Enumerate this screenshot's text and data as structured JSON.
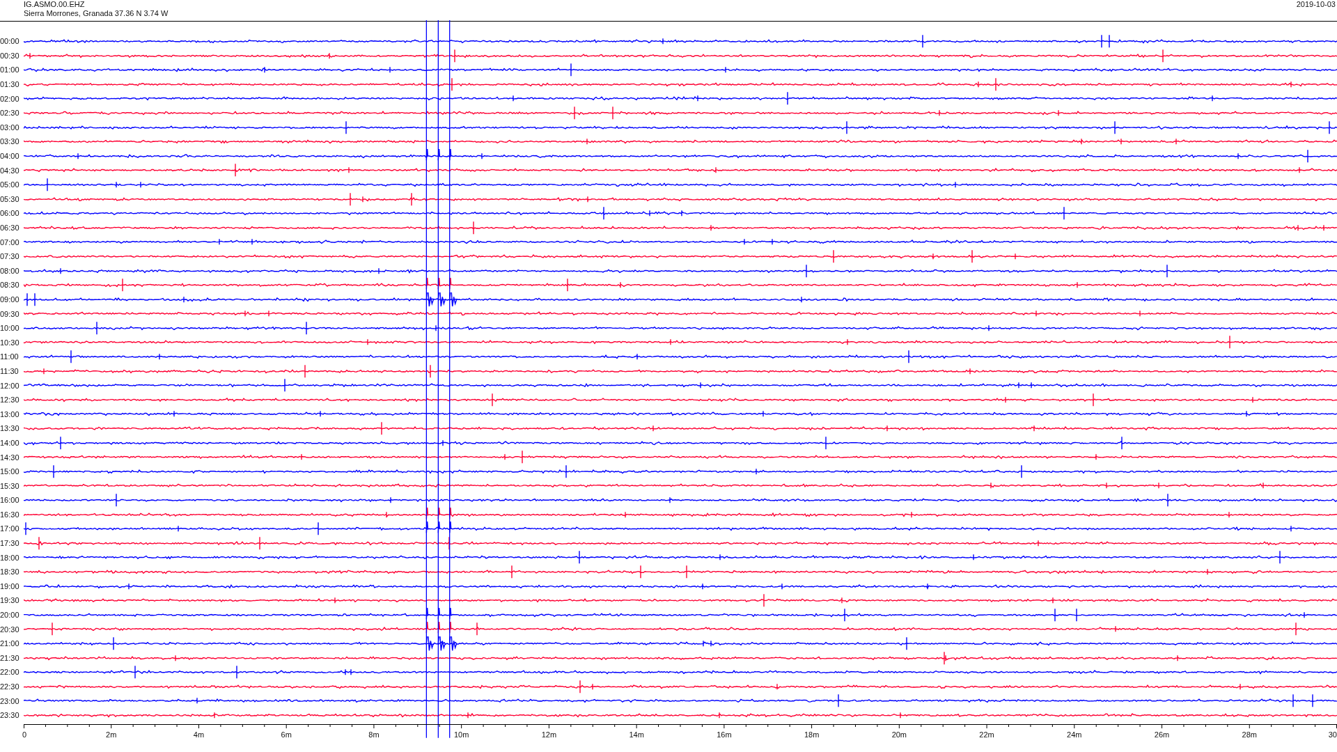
{
  "header": {
    "channel": "IG.ASMO.00.EHZ",
    "location": "Sierra Morrones, Granada  37.36 N 3.74 W",
    "date": "2019-10-03"
  },
  "rows": [
    {
      "label": "00:00",
      "color": "#0000ff"
    },
    {
      "label": "00:30",
      "color": "#ff0033"
    },
    {
      "label": "01:00",
      "color": "#0000ff"
    },
    {
      "label": "01:30",
      "color": "#ff0033"
    },
    {
      "label": "02:00",
      "color": "#0000ff"
    },
    {
      "label": "02:30",
      "color": "#ff0033"
    },
    {
      "label": "03:00",
      "color": "#0000ff"
    },
    {
      "label": "03:30",
      "color": "#ff0033"
    },
    {
      "label": "04:00",
      "color": "#0000ff"
    },
    {
      "label": "04:30",
      "color": "#ff0033"
    },
    {
      "label": "05:00",
      "color": "#0000ff"
    },
    {
      "label": "05:30",
      "color": "#ff0033"
    },
    {
      "label": "06:00",
      "color": "#0000ff"
    },
    {
      "label": "06:30",
      "color": "#ff0033"
    },
    {
      "label": "07:00",
      "color": "#0000ff"
    },
    {
      "label": "07:30",
      "color": "#ff0033"
    },
    {
      "label": "08:00",
      "color": "#0000ff"
    },
    {
      "label": "08:30",
      "color": "#ff0033"
    },
    {
      "label": "09:00",
      "color": "#0000ff"
    },
    {
      "label": "09:30",
      "color": "#ff0033"
    },
    {
      "label": "10:00",
      "color": "#0000ff"
    },
    {
      "label": "10:30",
      "color": "#ff0033"
    },
    {
      "label": "11:00",
      "color": "#0000ff"
    },
    {
      "label": "11:30",
      "color": "#ff0033"
    },
    {
      "label": "12:00",
      "color": "#0000ff"
    },
    {
      "label": "12:30",
      "color": "#ff0033"
    },
    {
      "label": "13:00",
      "color": "#0000ff"
    },
    {
      "label": "13:30",
      "color": "#ff0033"
    },
    {
      "label": "14:00",
      "color": "#0000ff"
    },
    {
      "label": "14:30",
      "color": "#ff0033"
    },
    {
      "label": "15:00",
      "color": "#0000ff"
    },
    {
      "label": "15:30",
      "color": "#ff0033"
    },
    {
      "label": "16:00",
      "color": "#0000ff"
    },
    {
      "label": "16:30",
      "color": "#ff0033"
    },
    {
      "label": "17:00",
      "color": "#0000ff"
    },
    {
      "label": "17:30",
      "color": "#ff0033"
    },
    {
      "label": "18:00",
      "color": "#0000ff"
    },
    {
      "label": "18:30",
      "color": "#ff0033"
    },
    {
      "label": "19:00",
      "color": "#0000ff"
    },
    {
      "label": "19:30",
      "color": "#ff0033"
    },
    {
      "label": "20:00",
      "color": "#0000ff"
    },
    {
      "label": "20:30",
      "color": "#ff0033"
    },
    {
      "label": "21:00",
      "color": "#0000ff"
    },
    {
      "label": "21:30",
      "color": "#ff0033"
    },
    {
      "label": "22:00",
      "color": "#0000ff"
    },
    {
      "label": "22:30",
      "color": "#ff0033"
    },
    {
      "label": "23:00",
      "color": "#0000ff"
    },
    {
      "label": "23:30",
      "color": "#ff0033"
    }
  ],
  "x_axis": {
    "labels": [
      "0",
      "2m",
      "4m",
      "6m",
      "8m",
      "10m",
      "12m",
      "14m",
      "16m",
      "18m",
      "20m",
      "22m",
      "24m",
      "26m",
      "28m",
      "30"
    ]
  }
}
